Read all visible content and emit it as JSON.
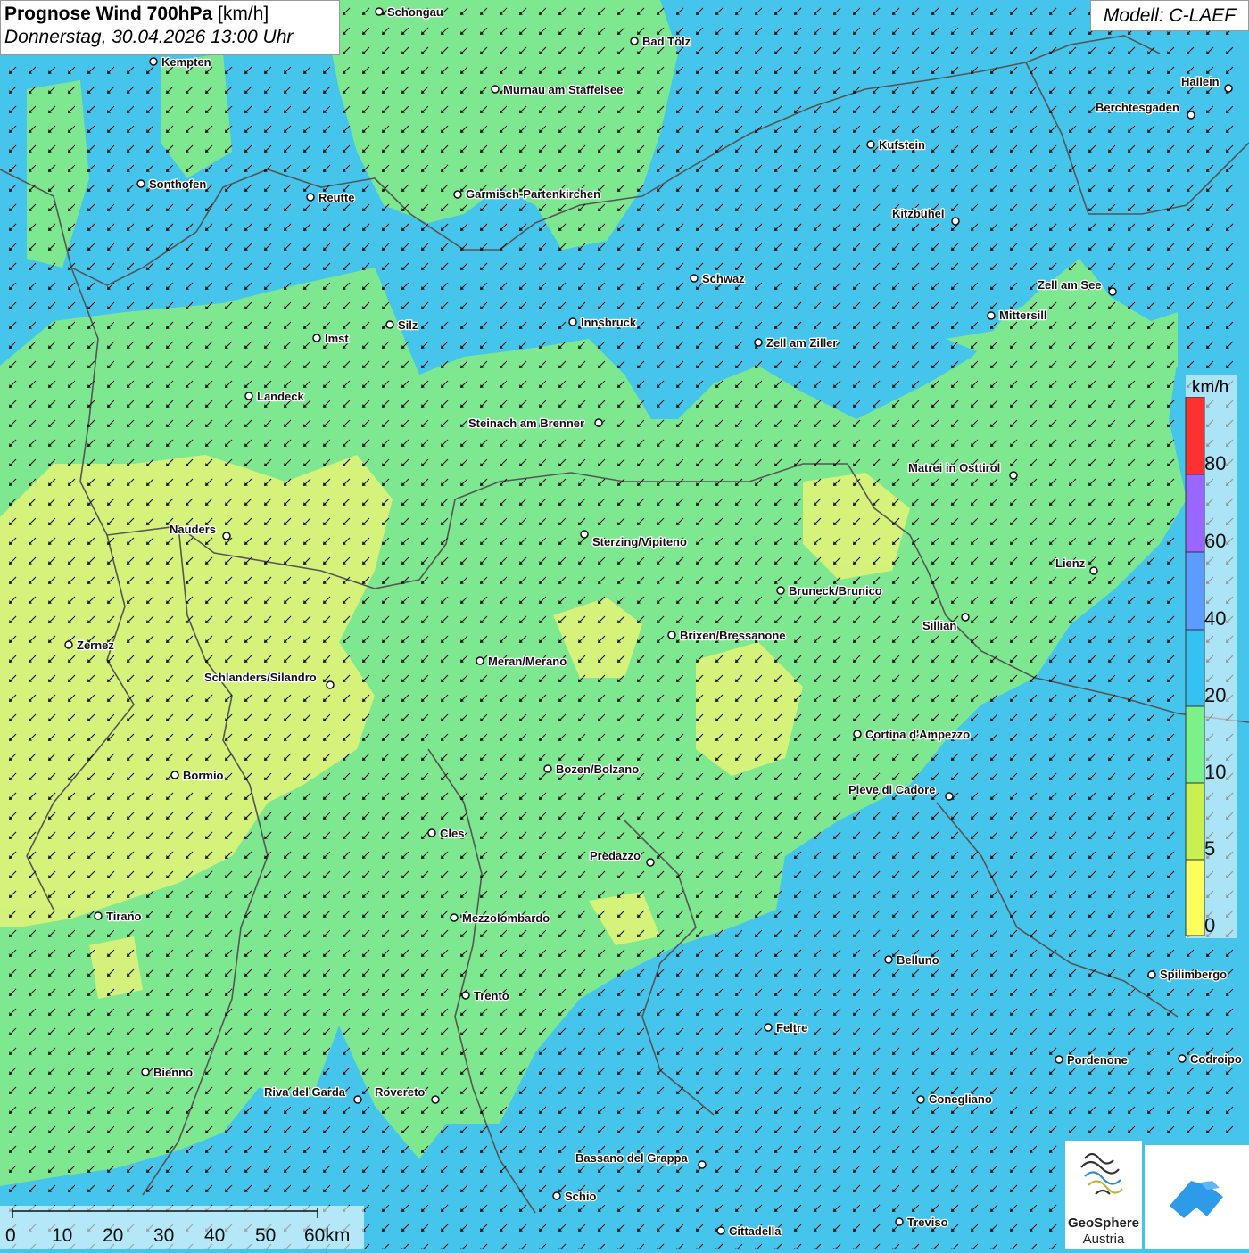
{
  "title": {
    "main": "Prognose Wind 700hPa",
    "unit": "[km/h]",
    "datetime": "Donnerstag, 30.04.2026 13:00 Uhr"
  },
  "model": "Modell: C-LAEF",
  "legend": {
    "unit": "km/h",
    "labels": [
      "80",
      "60",
      "40",
      "20",
      "10",
      "5",
      "0"
    ],
    "colors": [
      "#ff3030",
      "#9966ff",
      "#5c9cff",
      "#33c2f2",
      "#7cf089",
      "#c8f050",
      "#ffff5c"
    ]
  },
  "scalebar": {
    "labels": [
      "0",
      "10",
      "20",
      "30",
      "40",
      "50",
      "60km"
    ]
  },
  "logo": {
    "name_line1": "GeoSphere",
    "name_line2": "Austria"
  },
  "colors": {
    "wind_low": "#7ee891",
    "wind_calm": "#dcf37a",
    "wind_moderate": "#45c4ec",
    "border": "#555555",
    "arrow": "#111111"
  },
  "cities": [
    {
      "name": "Schongau"
    },
    {
      "name": "Bad Tölz"
    },
    {
      "name": "Kempten"
    },
    {
      "name": "Murnau am Staffelsee"
    },
    {
      "name": "Hallein"
    },
    {
      "name": "Berchtesgaden"
    },
    {
      "name": "Kufstein"
    },
    {
      "name": "Sonthofen"
    },
    {
      "name": "Reutte"
    },
    {
      "name": "Garmisch-Partenkirchen"
    },
    {
      "name": "Kitzbühel"
    },
    {
      "name": "Schwaz"
    },
    {
      "name": "Zell am See"
    },
    {
      "name": "Mittersill"
    },
    {
      "name": "Innsbruck"
    },
    {
      "name": "Silz"
    },
    {
      "name": "Imst"
    },
    {
      "name": "Zell am Ziller"
    },
    {
      "name": "Landeck"
    },
    {
      "name": "Steinach am Brenner"
    },
    {
      "name": "Matrei in Osttirol"
    },
    {
      "name": "Nauders"
    },
    {
      "name": "Sterzing/Vipiteno"
    },
    {
      "name": "Lienz"
    },
    {
      "name": "Bruneck/Brunico"
    },
    {
      "name": "Sillian"
    },
    {
      "name": "Brixen/Bressanone"
    },
    {
      "name": "Zernez"
    },
    {
      "name": "Meran/Merano"
    },
    {
      "name": "Schlanders/Silandro"
    },
    {
      "name": "Cortina d'Ampezzo"
    },
    {
      "name": "Bozen/Bolzano"
    },
    {
      "name": "Bormio"
    },
    {
      "name": "Pieve di Cadore"
    },
    {
      "name": "Cles"
    },
    {
      "name": "Predazzo"
    },
    {
      "name": "Tirano"
    },
    {
      "name": "Mezzolombardo"
    },
    {
      "name": "Belluno"
    },
    {
      "name": "Spilimbergo"
    },
    {
      "name": "Trento"
    },
    {
      "name": "Feltre"
    },
    {
      "name": "Pordenone"
    },
    {
      "name": "Codroipo"
    },
    {
      "name": "Bienno"
    },
    {
      "name": "Riva del Garda"
    },
    {
      "name": "Rovereto"
    },
    {
      "name": "Conegliano"
    },
    {
      "name": "Bassano del Grappa"
    },
    {
      "name": "Schio"
    },
    {
      "name": "Treviso"
    },
    {
      "name": "Cittadella"
    }
  ]
}
